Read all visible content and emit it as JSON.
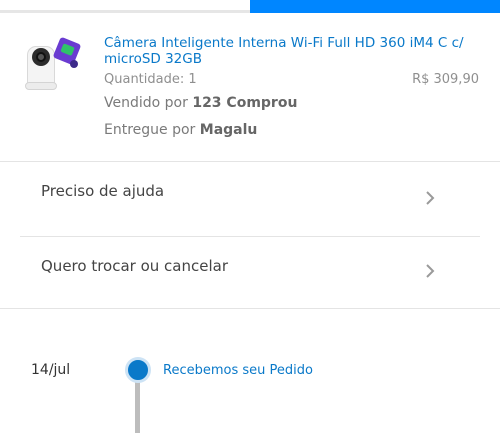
{
  "product": {
    "title": "Câmera Inteligente Interna Wi-Fi Full HD 360 iM4 C c/ microSD 32GB",
    "quantity_label": "Quantidade: 1",
    "price": "R$ 309,90",
    "sold_by_prefix": "Vendido por",
    "sold_by_seller": "123 Comprou",
    "delivered_by_prefix": "Entregue por",
    "delivered_by_store": "Magalu"
  },
  "menu": {
    "help_label": "Preciso de ajuda",
    "exchange_label": "Quero trocar ou cancelar"
  },
  "timeline": {
    "date": "14/jul",
    "status": "Recebemos seu Pedido"
  },
  "colors": {
    "accent": "#0086ff",
    "link": "#0a79c9"
  }
}
